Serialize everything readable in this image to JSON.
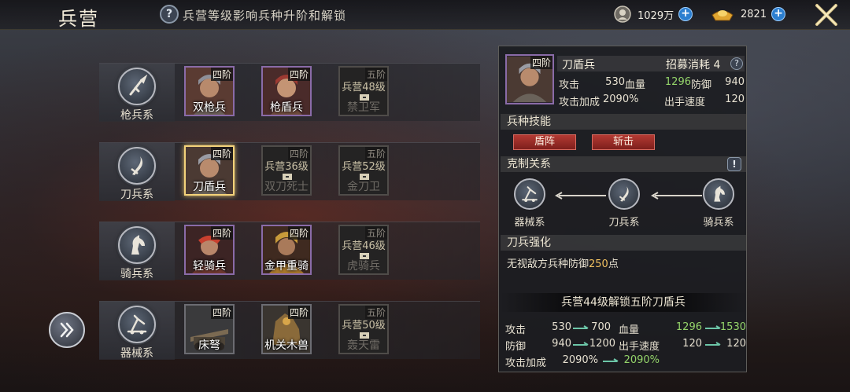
{
  "header": {
    "title": "兵营",
    "help_icon": "question-icon",
    "hint": "兵营等级影响兵种升阶和解锁",
    "resources": [
      {
        "icon": "silver-coin-icon",
        "value": "1029万"
      },
      {
        "icon": "gold-ingot-icon",
        "value": "2821"
      }
    ],
    "close_icon": "close-icon"
  },
  "branches": [
    {
      "label": "枪兵系",
      "icon": "spear-icon",
      "units": [
        {
          "name": "双枪兵",
          "tier": "四阶",
          "locked": false
        },
        {
          "name": "枪盾兵",
          "tier": "四阶",
          "locked": false
        },
        {
          "name": "禁卫军",
          "tier": "五阶",
          "locked": true,
          "requirement": "兵营48级"
        }
      ]
    },
    {
      "label": "刀兵系",
      "icon": "blade-icon",
      "units": [
        {
          "name": "刀盾兵",
          "tier": "四阶",
          "locked": false,
          "selected": true
        },
        {
          "name": "双刀死士",
          "tier": "四阶",
          "locked": true,
          "requirement": "兵营36级"
        },
        {
          "name": "金刀卫",
          "tier": "五阶",
          "locked": true,
          "requirement": "兵营52级"
        }
      ]
    },
    {
      "label": "骑兵系",
      "icon": "horse-icon",
      "units": [
        {
          "name": "轻骑兵",
          "tier": "四阶",
          "locked": false
        },
        {
          "name": "金甲重骑",
          "tier": "四阶",
          "locked": false
        },
        {
          "name": "虎骑兵",
          "tier": "五阶",
          "locked": true,
          "requirement": "兵营46级"
        }
      ]
    },
    {
      "label": "器械系",
      "icon": "catapult-icon",
      "units": [
        {
          "name": "床弩",
          "tier": "四阶",
          "locked": false
        },
        {
          "name": "机关木兽",
          "tier": "四阶",
          "locked": false
        },
        {
          "name": "轰天雷",
          "tier": "五阶",
          "locked": true,
          "requirement": "兵营50级"
        }
      ]
    }
  ],
  "next_button_icon": "double-chevron-right-icon",
  "detail": {
    "tier": "四阶",
    "name": "刀盾兵",
    "recruit_cost": "招募消耗 4",
    "recruit_help": "?",
    "stats": {
      "attack_label": "攻击",
      "attack": "530",
      "hp_label": "血量",
      "hp": "1296",
      "defense_label": "防御",
      "defense": "940",
      "atk_bonus_label": "攻击加成",
      "atk_bonus": "2090%",
      "speed_label": "出手速度",
      "speed": "120"
    },
    "skills_title": "兵种技能",
    "skills": [
      "盾阵",
      "斩击"
    ],
    "counter_title": "克制关系",
    "counter_info": "!",
    "counter": [
      {
        "label": "器械系",
        "icon": "catapult-icon"
      },
      {
        "label": "刀兵系",
        "icon": "blade-icon"
      },
      {
        "label": "骑兵系",
        "icon": "horse-icon"
      }
    ],
    "passive_title": "刀兵强化",
    "passive_prefix": "无视敌方兵种防御",
    "passive_value": "250",
    "passive_suffix": "点",
    "unlock_text": "兵营44级解锁五阶刀盾兵",
    "compare": {
      "attack_label": "攻击",
      "attack_from": "530",
      "attack_to": "700",
      "hp_label": "血量",
      "hp_from": "1296",
      "hp_to": "1530",
      "defense_label": "防御",
      "defense_from": "940",
      "defense_to": "1200",
      "speed_label": "出手速度",
      "speed_from": "120",
      "speed_to": "120",
      "atk_bonus_label": "攻击加成",
      "atk_bonus_from": "2090%",
      "atk_bonus_to": "2090%"
    }
  }
}
